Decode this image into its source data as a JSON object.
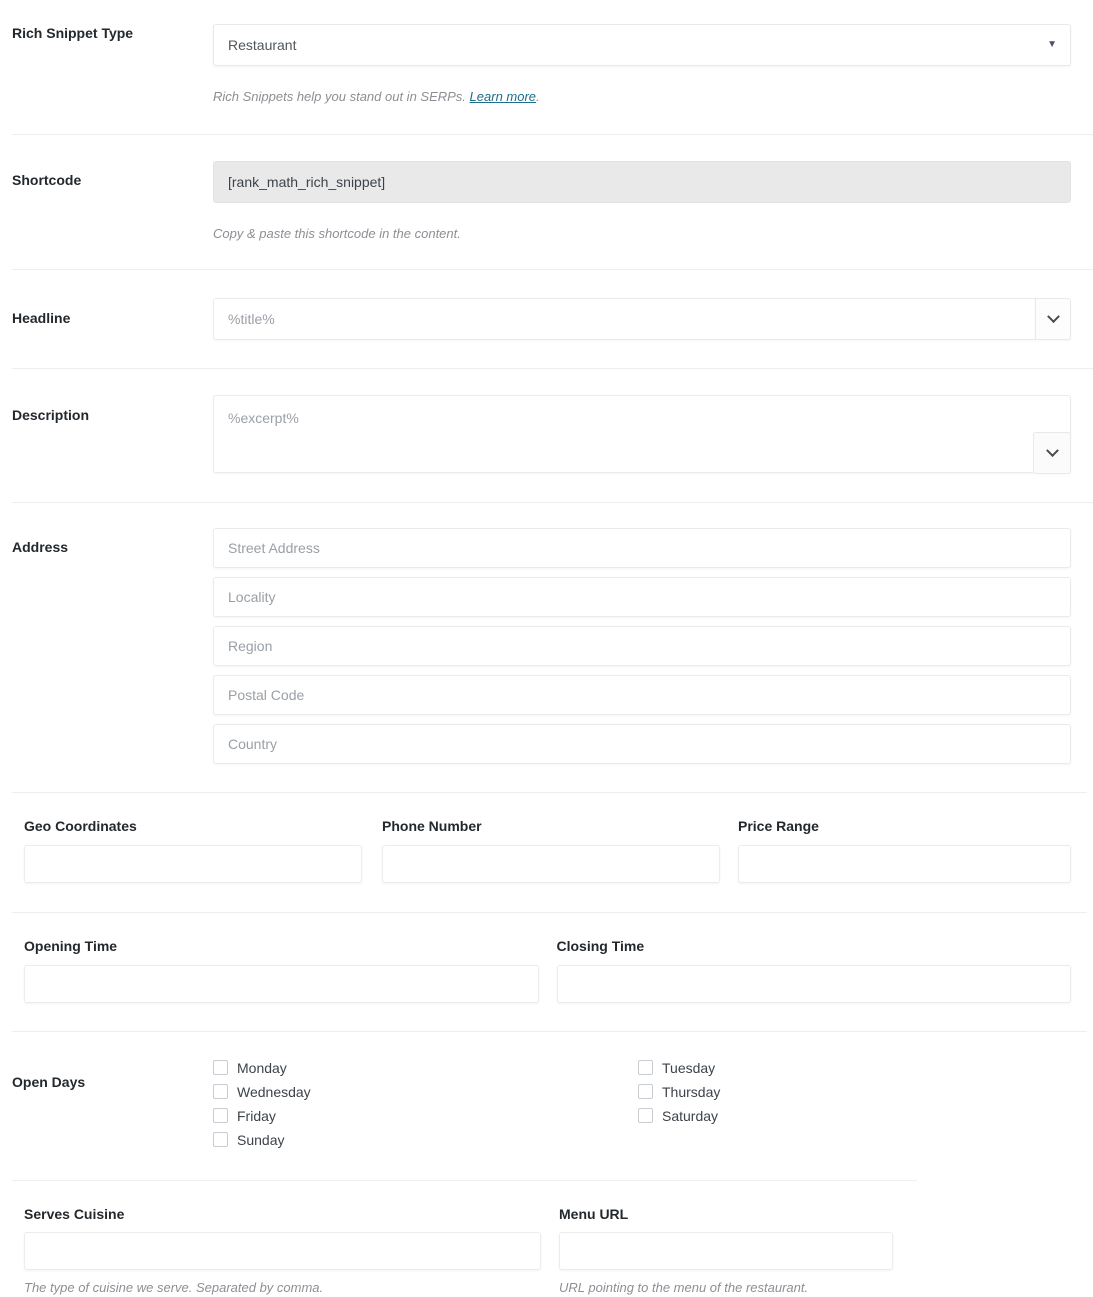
{
  "form": {
    "rich_snippet_type": {
      "label": "Rich Snippet Type",
      "value": "Restaurant",
      "options": [
        "Restaurant"
      ],
      "help_text_before": "Rich Snippets help you stand out in SERPs. ",
      "help_link": "Learn more",
      "help_text_after": ".",
      "arrow_icon": "caret-down-icon"
    },
    "shortcode": {
      "label": "Shortcode",
      "value": "[rank_math_rich_snippet]",
      "help": "Copy & paste this shortcode in the content."
    },
    "headline": {
      "label": "Headline",
      "value": "%title%",
      "toggle_icon": "chevron-down-icon"
    },
    "description": {
      "label": "Description",
      "value": "%excerpt%",
      "toggle_icon": "chevron-down-icon"
    },
    "address": {
      "label": "Address",
      "fields": [
        {
          "placeholder": "Street Address",
          "value": ""
        },
        {
          "placeholder": "Locality",
          "value": ""
        },
        {
          "placeholder": "Region",
          "value": ""
        },
        {
          "placeholder": "Postal Code",
          "value": ""
        },
        {
          "placeholder": "Country",
          "value": ""
        }
      ]
    },
    "geo_row": [
      {
        "label": "Geo Coordinates",
        "value": ""
      },
      {
        "label": "Phone Number",
        "value": ""
      },
      {
        "label": "Price Range",
        "value": ""
      }
    ],
    "time_row": [
      {
        "label": "Opening Time",
        "value": ""
      },
      {
        "label": "Closing Time",
        "value": ""
      }
    ],
    "open_days": {
      "label": "Open Days",
      "column_left": [
        {
          "label": "Monday",
          "checked": false
        },
        {
          "label": "Wednesday",
          "checked": false
        },
        {
          "label": "Friday",
          "checked": false
        },
        {
          "label": "Sunday",
          "checked": false
        }
      ],
      "column_right": [
        {
          "label": "Tuesday",
          "checked": false
        },
        {
          "label": "Thursday",
          "checked": false
        },
        {
          "label": "Saturday",
          "checked": false
        }
      ]
    },
    "cuisine_row": [
      {
        "label": "Serves Cuisine",
        "value": "",
        "help": "The type of cuisine we serve. Separated by comma."
      },
      {
        "label": "Menu URL",
        "value": "",
        "help": "URL pointing to the menu of the restaurant."
      }
    ]
  },
  "colors": {
    "link": "#1c6e8c",
    "label": "#23282d",
    "help": "#8c8f94",
    "border": "#ebebeb",
    "shortcode_bg": "#e9e9e9",
    "divider": "#eeeeee"
  }
}
